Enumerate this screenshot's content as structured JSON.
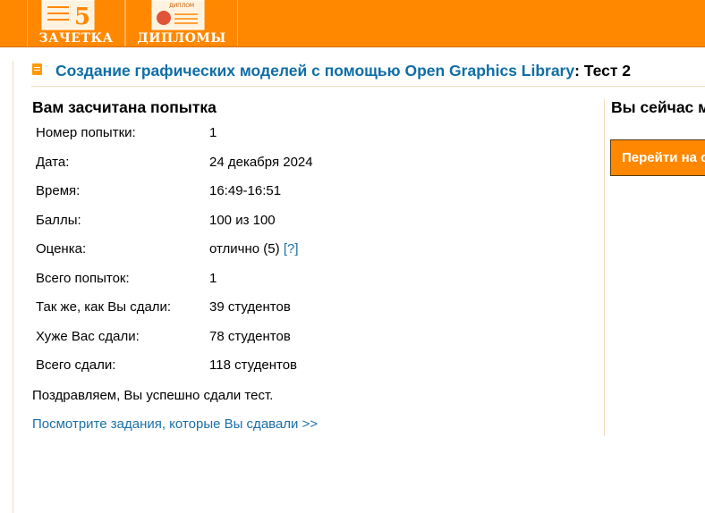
{
  "nav": {
    "record_book": {
      "caption": "ЗАЧЕТКА",
      "badge": "5"
    },
    "diplomas": {
      "caption": "ДИПЛОМЫ",
      "badge": "ДИПЛОМ"
    }
  },
  "title": {
    "course_link": "Создание графических моделей с помощью Open Graphics Library",
    "suffix": ": Тест 2"
  },
  "result": {
    "heading": "Вам засчитана попытка",
    "rows": [
      {
        "label": "Номер попытки:",
        "value": "1"
      },
      {
        "label": "Дата:",
        "value": "24 декабря 2024"
      },
      {
        "label": "Время:",
        "value": "16:49-16:51"
      },
      {
        "label": "Баллы:",
        "value": "100 из 100"
      },
      {
        "label": "Оценка:",
        "value": "отлично (5)",
        "hint": "[?]"
      },
      {
        "label": "Всего попыток:",
        "value": "1"
      },
      {
        "label": "Так же, как Вы сдали:",
        "value": "39 студентов"
      },
      {
        "label": "Хуже Вас сдали:",
        "value": "78 студентов"
      },
      {
        "label": "Всего сдали:",
        "value": "118 студентов"
      }
    ],
    "congrats": "Поздравляем, Вы успешно сдали тест.",
    "view_tasks_link": "Посмотрите задания, которые Вы сдавали >>"
  },
  "sidebar": {
    "heading": "Вы сейчас м",
    "button_label": "Перейти на с"
  },
  "colors": {
    "brand_orange": "#ff8800",
    "link_blue": "#0f6ea6"
  }
}
